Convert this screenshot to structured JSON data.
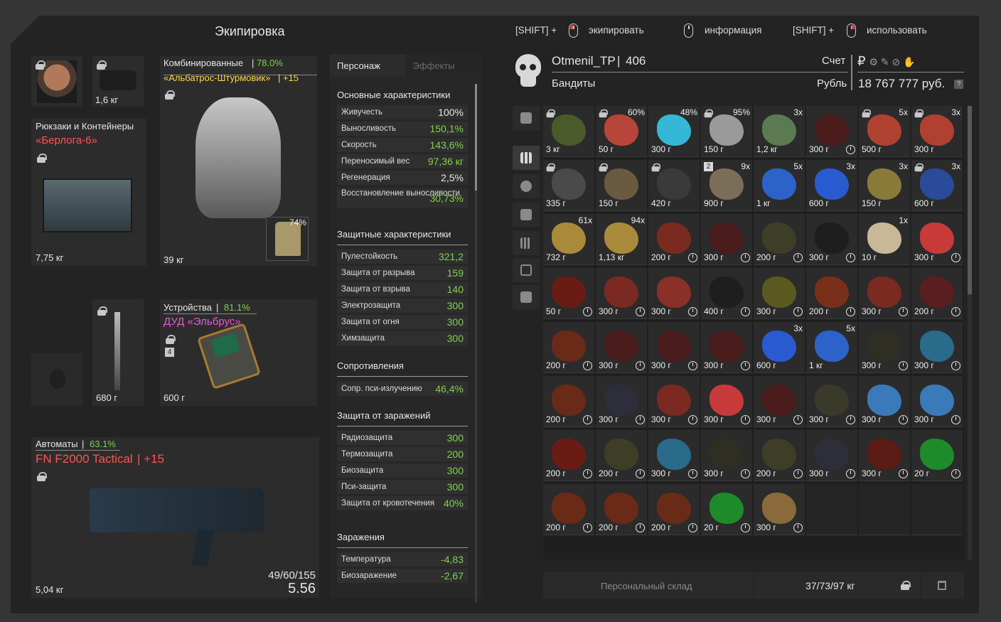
{
  "header": {
    "title": "Экипировка"
  },
  "hints": {
    "h1_prefix": "[SHIFT] +",
    "h1_label": "экипировать",
    "h2_label": "информация",
    "h3_prefix": "[SHIFT] +",
    "h3_label": "использовать"
  },
  "equipment": {
    "helmet_weight": "1,6 кг",
    "armor": {
      "category": "Комбинированные",
      "sep": "|",
      "durability": "78.0%",
      "name": "«Альбатрос-Штурмовик»",
      "upgrade": "| +15",
      "weight": "39 кг",
      "plate_percent": "74%"
    },
    "backpack": {
      "category": "Рюкзаки и Контейнеры",
      "name": "«Берлога-6»",
      "weight": "7,75 кг"
    },
    "knife": {
      "weight": "680 г"
    },
    "device": {
      "category": "Устройства",
      "sep": "|",
      "durability": "81.1%",
      "name": "ДУД «Эльбрус»",
      "level": "4",
      "weight": "600 г"
    },
    "weapon": {
      "category": "Автоматы",
      "sep": "|",
      "durability": "63.1%",
      "name": "FN F2000 Tactical",
      "upgrade": "| +15",
      "ammo": "49/60/155",
      "rank": "5.56",
      "weight": "5,04 кг"
    }
  },
  "stats": {
    "tab_character": "Персонаж",
    "tab_effects": "Эффекты",
    "sections": {
      "main": "Основные характеристики",
      "protection": "Защитные характеристики",
      "resist": "Сопротивления",
      "contamination_protection": "Защита от заражений",
      "contamination": "Заражения"
    },
    "main": [
      {
        "n": "Живучесть",
        "v": "100%"
      },
      {
        "n": "Выносливость",
        "v": "150,1%"
      },
      {
        "n": "Скорость",
        "v": "143,6%"
      },
      {
        "n": "Переносимый вес",
        "v": "97,36 кг"
      },
      {
        "n": "Регенерация",
        "v": "2,5%"
      },
      {
        "n": "Восстановление выносливости",
        "v": "30,73%"
      }
    ],
    "protection": [
      {
        "n": "Пулестойкость",
        "v": "321,2"
      },
      {
        "n": "Защита от разрыва",
        "v": "159"
      },
      {
        "n": "Защита от взрыва",
        "v": "140"
      },
      {
        "n": "Электрозащита",
        "v": "300"
      },
      {
        "n": "Защита от огня",
        "v": "300"
      },
      {
        "n": "Химзащита",
        "v": "300"
      }
    ],
    "resist": [
      {
        "n": "Сопр. пси-излучению",
        "v": "46,4%"
      }
    ],
    "contamination_protection": [
      {
        "n": "Радиозащита",
        "v": "300"
      },
      {
        "n": "Термозащита",
        "v": "200"
      },
      {
        "n": "Биозащита",
        "v": "300"
      },
      {
        "n": "Пси-защита",
        "v": "300"
      },
      {
        "n": "Защита от кровотечения",
        "v": "40%"
      }
    ],
    "contamination": [
      {
        "n": "Температура",
        "v": "-4,83"
      },
      {
        "n": "Биозаражение",
        "v": "-2,67"
      }
    ]
  },
  "player": {
    "name": "Otmenil_TP",
    "sep": "|",
    "level": "406",
    "faction": "Бандиты",
    "account_label": "Счет",
    "currency_label": "Рубль",
    "balance": "18 767 777 руб.",
    "help": "?"
  },
  "inventory": {
    "items": [
      {
        "w": "3 кг",
        "c": "#4a5a2a",
        "lock": true
      },
      {
        "w": "50 г",
        "ct": "60%",
        "c": "#b8453a",
        "lock": true
      },
      {
        "w": "300 г",
        "ct": "48%",
        "c": "#35b8d8"
      },
      {
        "w": "150 г",
        "ct": "95%",
        "c": "#9a9a9a",
        "lock": true
      },
      {
        "w": "1,2 кг",
        "ct": "3x",
        "c": "#5b7a52"
      },
      {
        "w": "300 г",
        "c": "#4a1c1c",
        "clock": true
      },
      {
        "w": "500 г",
        "ct": "5x",
        "c": "#b04030",
        "lock": true
      },
      {
        "w": "300 г",
        "ct": "3x",
        "c": "#b04030",
        "lock": true
      },
      {
        "w": "335 г",
        "c": "#4a4a4a",
        "lock": true
      },
      {
        "w": "150 г",
        "c": "#6a5a40",
        "lock": true
      },
      {
        "w": "420 г",
        "c": "#3a3a3a",
        "lock": true
      },
      {
        "w": "900 г",
        "ct": "9x",
        "c": "#7a6e58",
        "badge": "2"
      },
      {
        "w": "1 кг",
        "ct": "5x",
        "c": "#2d62c8"
      },
      {
        "w": "600 г",
        "ct": "3x",
        "c": "#2a5ad0"
      },
      {
        "w": "150 г",
        "ct": "3x",
        "c": "#8a7a3a"
      },
      {
        "w": "600 г",
        "ct": "3x",
        "c": "#2a4a9a",
        "lock": true
      },
      {
        "w": "732 г",
        "ct": "61x",
        "c": "#a88a3a"
      },
      {
        "w": "1,13 кг",
        "ct": "94x",
        "c": "#a88a3a"
      },
      {
        "w": "200 г",
        "c": "#7a2a1e",
        "clock": true
      },
      {
        "w": "300 г",
        "c": "#4a1c1c",
        "clock": true
      },
      {
        "w": "200 г",
        "c": "#3e3e26",
        "clock": true
      },
      {
        "w": "300 г",
        "c": "#1e1e1e",
        "clock": true
      },
      {
        "w": "10 г",
        "ct": "1x",
        "c": "#c8b898"
      },
      {
        "w": "300 г",
        "c": "#c83a3a",
        "clock": true
      },
      {
        "w": "50 г",
        "c": "#6a1c14",
        "clock": true
      },
      {
        "w": "300 г",
        "c": "#7a2a20",
        "clock": true
      },
      {
        "w": "300 г",
        "c": "#8a3028",
        "clock": true
      },
      {
        "w": "400 г",
        "c": "#1e1e1e",
        "clock": true
      },
      {
        "w": "300 г",
        "c": "#5a5a20",
        "clock": true
      },
      {
        "w": "200 г",
        "c": "#7a3018",
        "clock": true
      },
      {
        "w": "300 г",
        "c": "#7a2a20",
        "clock": true
      },
      {
        "w": "200 г",
        "c": "#5a1e1e",
        "clock": true
      },
      {
        "w": "200 г",
        "c": "#6a2a18",
        "clock": true
      },
      {
        "w": "300 г",
        "c": "#4a1c1c",
        "clock": true
      },
      {
        "w": "300 г",
        "c": "#4a1c1c",
        "clock": true
      },
      {
        "w": "300 г",
        "c": "#4a1c1c",
        "clock": true
      },
      {
        "w": "600 г",
        "ct": "3x",
        "c": "#2a5ad0"
      },
      {
        "w": "1 кг",
        "ct": "5x",
        "c": "#2d62c8"
      },
      {
        "w": "300 г",
        "c": "#2e2e22",
        "clock": true
      },
      {
        "w": "300 г",
        "c": "#2a6a8a",
        "clock": true
      },
      {
        "w": "200 г",
        "c": "#6a2a18",
        "clock": true
      },
      {
        "w": "300 г",
        "c": "#2e2e3a",
        "clock": true
      },
      {
        "w": "300 г",
        "c": "#7a2a20",
        "clock": true
      },
      {
        "w": "300 г",
        "c": "#c83a3a",
        "clock": true
      },
      {
        "w": "300 г",
        "c": "#4a1c1c",
        "clock": true
      },
      {
        "w": "300 г",
        "c": "#3a3a2a",
        "clock": true
      },
      {
        "w": "300 г",
        "c": "#3a7ab8",
        "clock": true
      },
      {
        "w": "300 г",
        "c": "#3a7ab8",
        "clock": true
      },
      {
        "w": "200 г",
        "c": "#6a1c14",
        "clock": true
      },
      {
        "w": "200 г",
        "c": "#3e3e26",
        "clock": true
      },
      {
        "w": "300 г",
        "c": "#2a6a8a",
        "clock": true
      },
      {
        "w": "300 г",
        "c": "#2e2e22",
        "clock": true
      },
      {
        "w": "200 г",
        "c": "#3e3e26",
        "clock": true
      },
      {
        "w": "300 г",
        "c": "#2e2e3a",
        "clock": true
      },
      {
        "w": "300 г",
        "c": "#5a1c14",
        "clock": true
      },
      {
        "w": "20 г",
        "c": "#1e8a2a",
        "clock": true
      },
      {
        "w": "200 г",
        "c": "#6a2a18",
        "clock": true
      },
      {
        "w": "200 г",
        "c": "#6a2a18",
        "clock": true
      },
      {
        "w": "200 г",
        "c": "#6a2a18",
        "clock": true
      },
      {
        "w": "20 г",
        "c": "#1e8a2a",
        "clock": true
      },
      {
        "w": "300 г",
        "c": "#8a6a3a",
        "clock": true
      }
    ]
  },
  "footer": {
    "storage": "Персональный склад",
    "weight": "37/73/97 кг"
  }
}
